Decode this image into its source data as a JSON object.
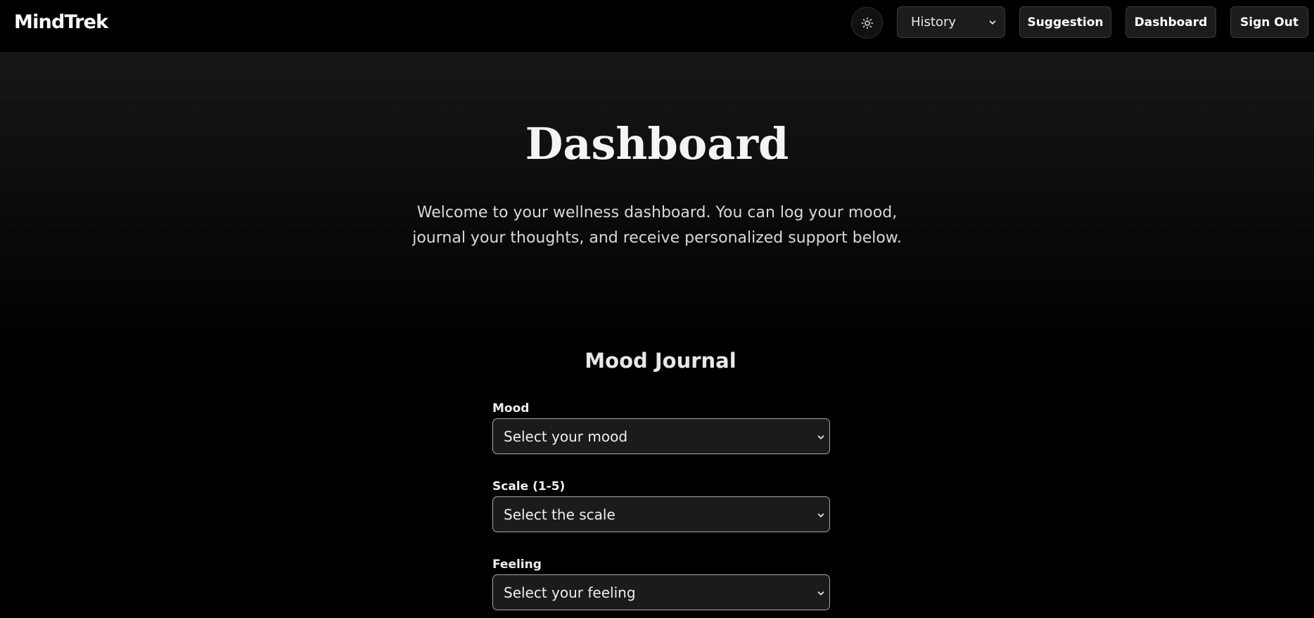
{
  "app": {
    "name": "MindTrek"
  },
  "nav": {
    "theme_toggle_icon": "sun-icon",
    "history_select": {
      "selected": "History",
      "icon": "chevron-down-icon"
    },
    "buttons": {
      "suggestion": "Suggestion",
      "dashboard": "Dashboard",
      "sign_out": "Sign Out"
    }
  },
  "page": {
    "title": "Dashboard",
    "intro": "Welcome to your wellness dashboard. You can log your mood, journal your thoughts, and receive personalized support below."
  },
  "journal": {
    "title": "Mood Journal",
    "fields": [
      {
        "label": "Mood",
        "placeholder": "Select your mood"
      },
      {
        "label": "Scale (1-5)",
        "placeholder": "Select the scale"
      },
      {
        "label": "Feeling",
        "placeholder": "Select your feeling"
      }
    ]
  },
  "colors": {
    "background": "#000000",
    "control_bg": "#1c1c1c",
    "control_border": "#3a3a3a",
    "field_border": "#a8a8a8",
    "text": "#f2f2f2"
  }
}
